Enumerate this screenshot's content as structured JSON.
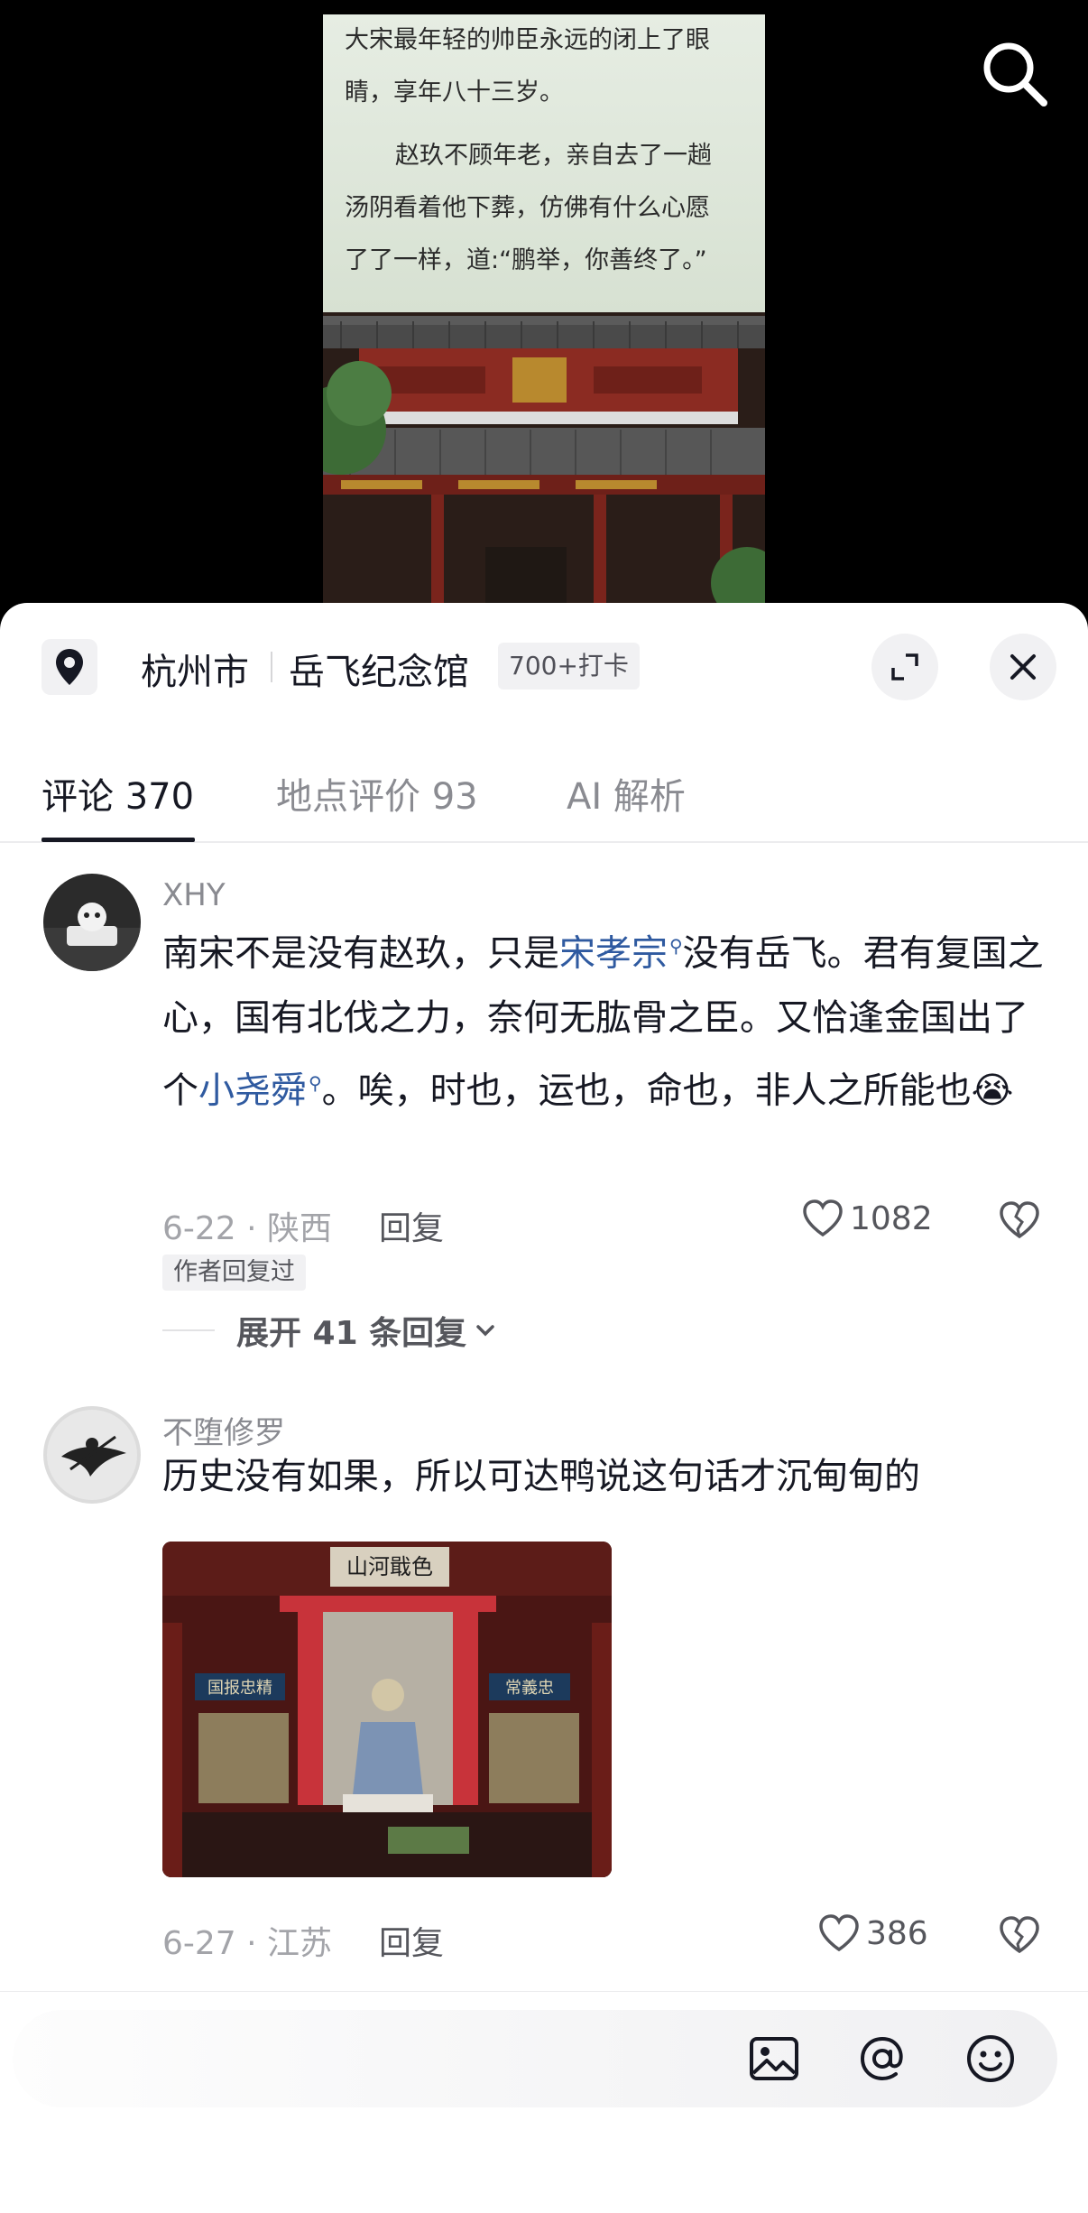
{
  "video": {
    "text_line1": "大宋最年轻的帅臣永远的闭上了眼",
    "text_line2": "睛，享年八十三岁。",
    "text_line3": "赵玖不顾年老，亲自去了一趟",
    "text_line4": "汤阴看着他下葬，仿佛有什么心愿",
    "text_line5": "了了一样，道:“鹏举，你善终了。”"
  },
  "location": {
    "city": "杭州市",
    "place": "岳飞纪念馆",
    "checkin": "700+打卡"
  },
  "tabs": [
    {
      "label": "评论 370"
    },
    {
      "label": "地点评价 93"
    },
    {
      "label": "AI 解析"
    }
  ],
  "comments": [
    {
      "author": "XHY",
      "text_part1": "南宋不是没有赵玖，只是",
      "link1": "宋孝宗",
      "text_part2": "没有岳飞。君有复国之心，国有北伐之力，奈何无肱骨之臣。又恰逢金国出了个",
      "link2": "小尧舜",
      "text_part3": "。唉，时也，运也，命也，非人之所能也",
      "emoji": "😭",
      "meta": "6-22 · 陕西",
      "reply": "回复",
      "likes": "1082",
      "badge": "作者回复过",
      "expand": "展开 41 条回复"
    },
    {
      "author": "不堕修罗",
      "text": "历史没有如果，所以可达鸭说这句话才沉甸甸的",
      "meta": "6-27 · 江苏",
      "reply": "回复",
      "likes": "386",
      "photo_sign_top": "山河戢色",
      "photo_sign_left": "国报忠精",
      "photo_sign_right": "常義忠"
    }
  ],
  "input": {
    "placeholder": ""
  },
  "colors": {
    "link": "#2f5aa0",
    "text": "#161823",
    "muted": "#8a8b91"
  },
  "icons": [
    "search-icon",
    "location-pin-icon",
    "expand-icon",
    "close-icon",
    "heart-icon",
    "broken-heart-icon",
    "chevron-down-icon",
    "image-icon",
    "at-icon",
    "emoji-icon"
  ]
}
